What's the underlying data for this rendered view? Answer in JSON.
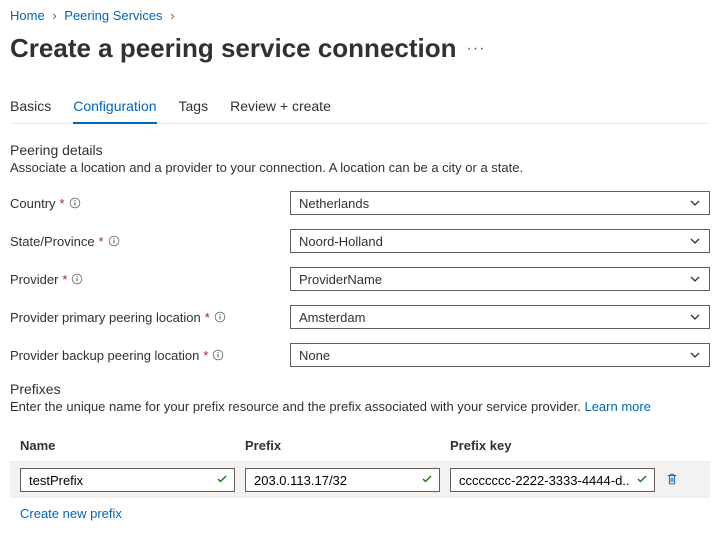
{
  "breadcrumb": {
    "home": "Home",
    "services": "Peering Services"
  },
  "page_title": "Create a peering service connection",
  "tabs": {
    "basics": "Basics",
    "config": "Configuration",
    "tags": "Tags",
    "review": "Review + create"
  },
  "peering": {
    "heading": "Peering details",
    "desc": "Associate a location and a provider to your connection. A location can be a city or a state.",
    "country_label": "Country",
    "country_value": "Netherlands",
    "state_label": "State/Province",
    "state_value": "Noord-Holland",
    "provider_label": "Provider",
    "provider_value": "ProviderName",
    "primary_label": "Provider primary peering location",
    "primary_value": "Amsterdam",
    "backup_label": "Provider backup peering location",
    "backup_value": "None"
  },
  "prefixes": {
    "heading": "Prefixes",
    "desc": "Enter the unique name for your prefix resource and the prefix associated with your service provider. ",
    "learn_more": "Learn more",
    "col_name": "Name",
    "col_prefix": "Prefix",
    "col_key": "Prefix key",
    "row": {
      "name": "testPrefix",
      "prefix": "203.0.113.17/32",
      "key": "cccccccc-2222-3333-4444-d..."
    },
    "create_new": "Create new prefix"
  },
  "glyphs": {
    "required": "*",
    "more": "···"
  }
}
